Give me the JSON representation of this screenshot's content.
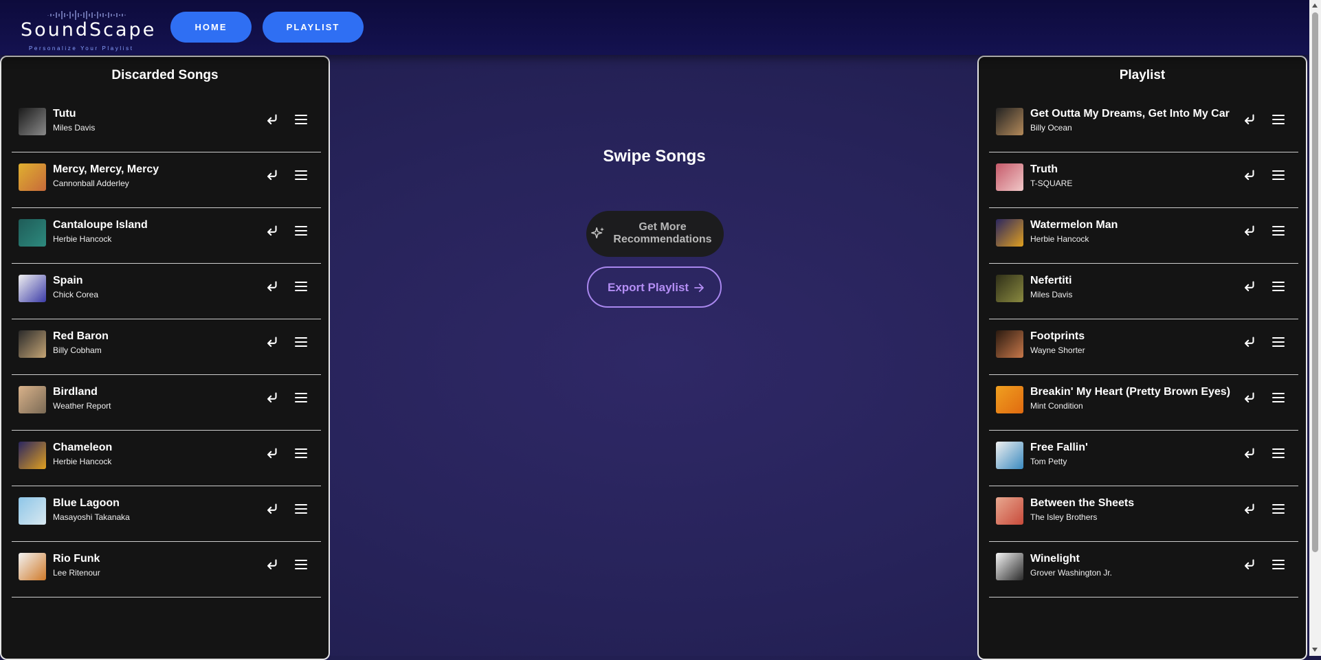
{
  "header": {
    "logo_name": "SoundScape",
    "logo_tagline": "Personalize Your Playlist",
    "nav": {
      "home_label": "HOME",
      "playlist_label": "PLAYLIST"
    }
  },
  "discarded": {
    "title": "Discarded Songs",
    "songs": [
      {
        "title": "Tutu",
        "artist": "Miles Davis",
        "cover": [
          "#1a1a1a",
          "#8a8a8a"
        ]
      },
      {
        "title": "Mercy, Mercy, Mercy",
        "artist": "Cannonball Adderley",
        "cover": [
          "#e0b030",
          "#c76a3a"
        ]
      },
      {
        "title": "Cantaloupe Island",
        "artist": "Herbie Hancock",
        "cover": [
          "#1f5c58",
          "#2d8a7e"
        ]
      },
      {
        "title": "Spain",
        "artist": "Chick Corea",
        "cover": [
          "#f0f0f0",
          "#3c3ca8"
        ]
      },
      {
        "title": "Red Baron",
        "artist": "Billy Cobham",
        "cover": [
          "#2a2a2a",
          "#c5a575"
        ]
      },
      {
        "title": "Birdland",
        "artist": "Weather Report",
        "cover": [
          "#d9b28a",
          "#7a6a55"
        ]
      },
      {
        "title": "Chameleon",
        "artist": "Herbie Hancock",
        "cover": [
          "#2a2660",
          "#e0a020"
        ]
      },
      {
        "title": "Blue Lagoon",
        "artist": "Masayoshi Takanaka",
        "cover": [
          "#8ec6e8",
          "#d8e8f0"
        ]
      },
      {
        "title": "Rio Funk",
        "artist": "Lee Ritenour",
        "cover": [
          "#f2f2f2",
          "#d07a2a"
        ]
      }
    ]
  },
  "center": {
    "title": "Swipe Songs",
    "recommend_label": "Get More Recommendations",
    "export_label": "Export Playlist"
  },
  "playlist": {
    "title": "Playlist",
    "songs": [
      {
        "title": "Get Outta My Dreams, Get Into My Car",
        "artist": "Billy Ocean",
        "cover": [
          "#222222",
          "#b48a5a"
        ]
      },
      {
        "title": "Truth",
        "artist": "T-SQUARE",
        "cover": [
          "#c65a6a",
          "#f0c8c8"
        ]
      },
      {
        "title": "Watermelon Man",
        "artist": "Herbie Hancock",
        "cover": [
          "#2a2660",
          "#e0a020"
        ]
      },
      {
        "title": "Nefertiti",
        "artist": "Miles Davis",
        "cover": [
          "#2f2f18",
          "#8a8a40"
        ]
      },
      {
        "title": "Footprints",
        "artist": "Wayne Shorter",
        "cover": [
          "#2a1a10",
          "#c8784a"
        ]
      },
      {
        "title": "Breakin' My Heart (Pretty Brown Eyes)",
        "artist": "Mint Condition",
        "cover": [
          "#f0a020",
          "#e06a10"
        ]
      },
      {
        "title": "Free Fallin'",
        "artist": "Tom Petty",
        "cover": [
          "#f0f0f0",
          "#3a8ac0"
        ]
      },
      {
        "title": "Between the Sheets",
        "artist": "The Isley Brothers",
        "cover": [
          "#e8a890",
          "#c84a3a"
        ]
      },
      {
        "title": "Winelight",
        "artist": "Grover Washington Jr.",
        "cover": [
          "#f5f5f5",
          "#2a2a2a"
        ]
      }
    ]
  },
  "icons": {
    "undo": "undo-arrow-icon",
    "menu": "hamburger-menu-icon",
    "sparkle": "sparkle-icon",
    "arrow": "arrow-right-icon"
  },
  "colors": {
    "nav_button": "#2f6ff3",
    "panel_bg": "#141414",
    "export_accent": "#b48ef5",
    "header_bg": "#0d0b3c"
  }
}
